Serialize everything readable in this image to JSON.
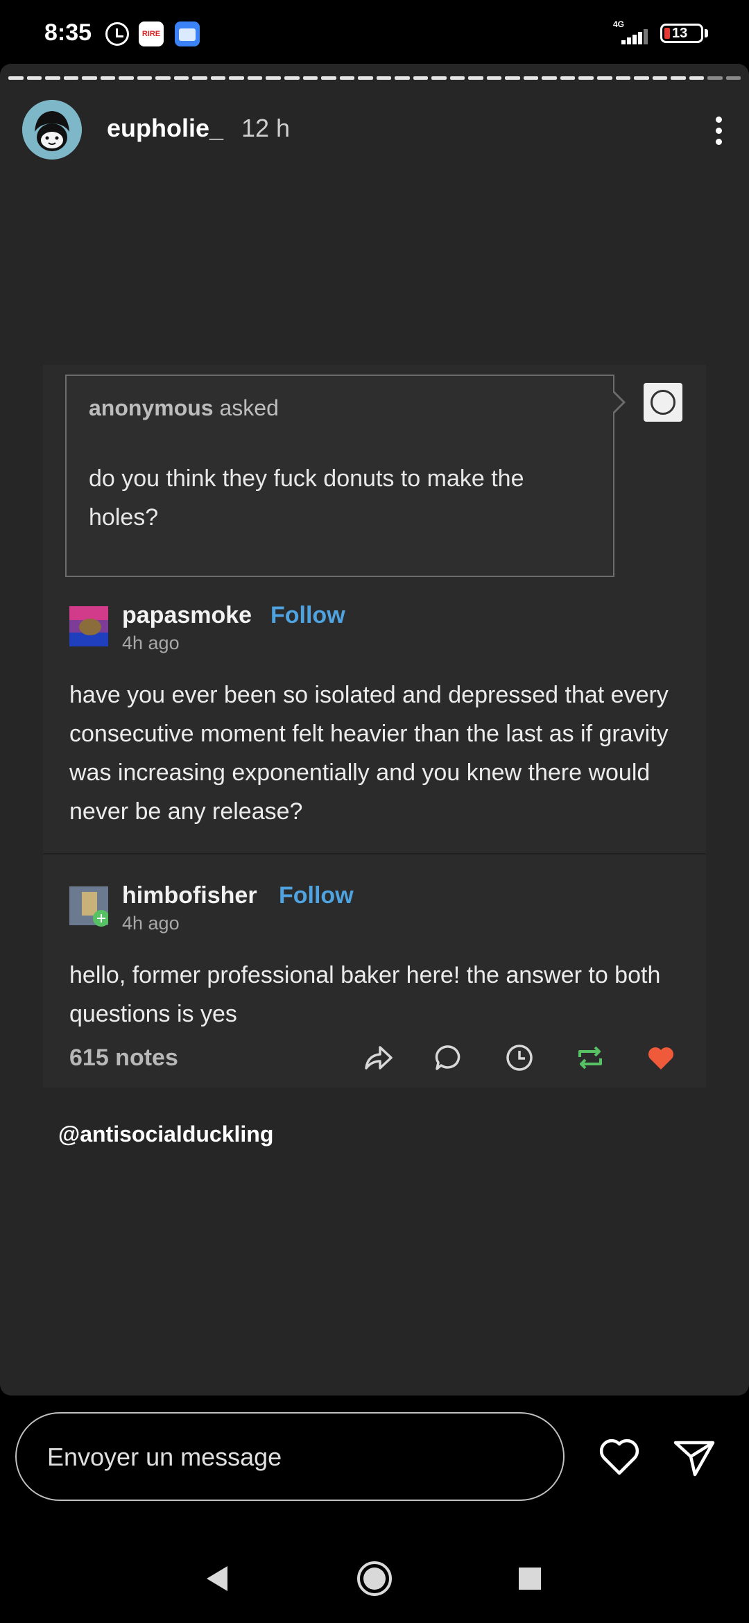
{
  "status_bar": {
    "time": "8:35",
    "network": "4G",
    "battery": "13",
    "icons": [
      "alarm-icon",
      "app-notification-icon",
      "calendar-icon",
      "signal-icon",
      "battery-icon"
    ]
  },
  "story": {
    "username": "eupholie_",
    "time_ago": "12 h",
    "progress_segments": 40,
    "progress_viewed": 38
  },
  "post": {
    "asker": "anonymous",
    "asked_word": "asked",
    "question": "do you think they fuck donuts to make the holes?",
    "replies": [
      {
        "name": "papasmoke",
        "follow": "Follow",
        "time": "4h ago",
        "body": "have you ever been so isolated and depressed that every consecutive moment felt heavier than the last as if gravity was increasing exponentially and you knew there would never be any release?"
      },
      {
        "name": "himbofisher",
        "follow": "Follow",
        "time": "4h ago",
        "body": "hello, former professional baker here! the answer to both questions is yes"
      }
    ],
    "notes": "615 notes",
    "actions": [
      "share-icon",
      "comment-icon",
      "clock-icon",
      "reblog-icon",
      "heart-icon"
    ],
    "liked_color": "#ee5a3a",
    "reblog_color": "#57c264",
    "follow_color": "#4ea3e0"
  },
  "mention": "@antisocialduckling",
  "reply_bar": {
    "placeholder": "Envoyer un message"
  },
  "nav": [
    "back-icon",
    "home-icon",
    "recents-icon"
  ]
}
